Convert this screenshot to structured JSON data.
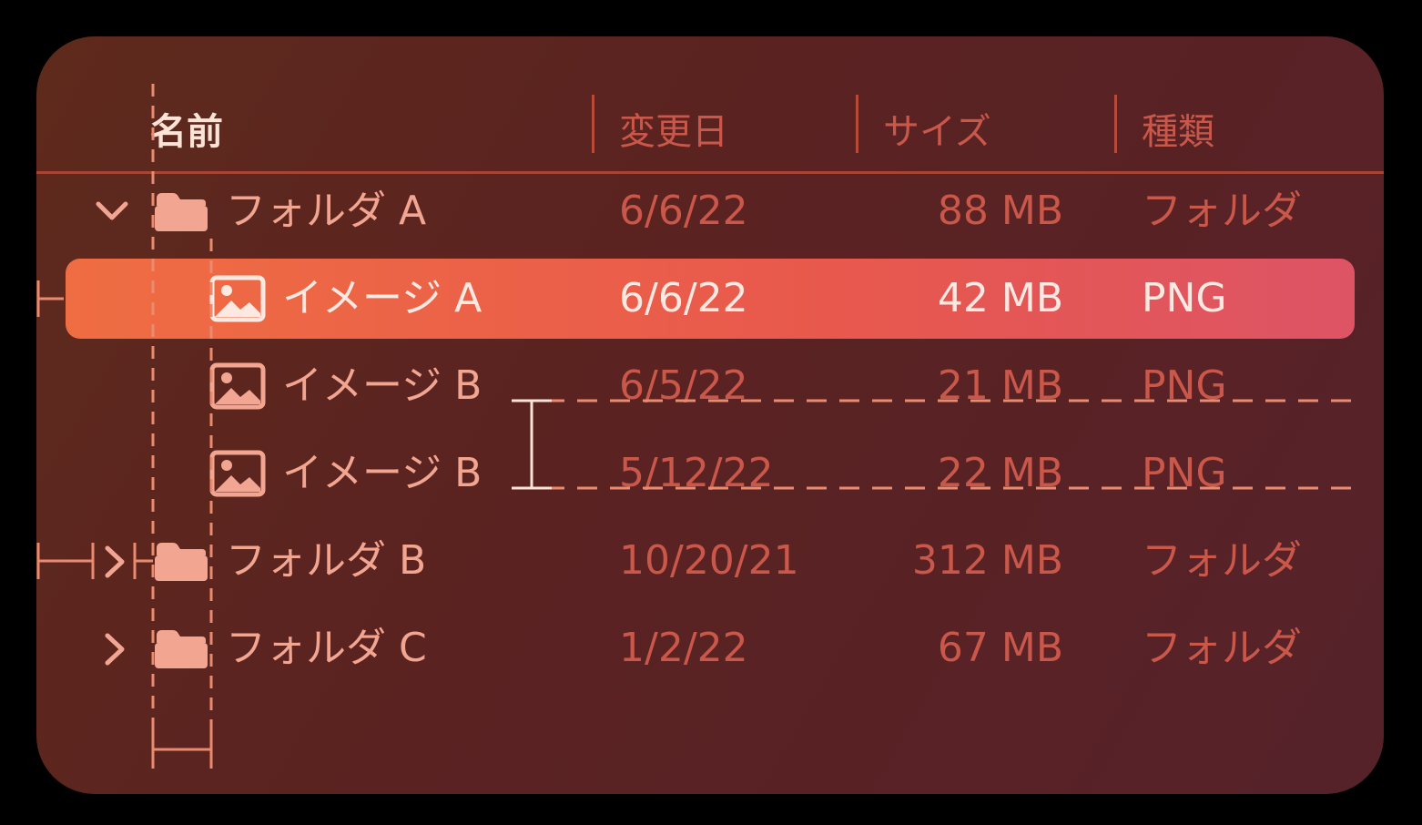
{
  "columns": {
    "name": "名前",
    "modified": "変更日",
    "size": "サイズ",
    "kind": "種類"
  },
  "rows": [
    {
      "name": "フォルダ A",
      "date": "6/6/22",
      "size": "88 MB",
      "kind": "フォルダ",
      "type": "folder",
      "expanded": true,
      "selected": false
    },
    {
      "name": "イメージ A",
      "date": "6/6/22",
      "size": "42 MB",
      "kind": "PNG",
      "type": "image",
      "selected": true
    },
    {
      "name": "イメージ B",
      "date": "6/5/22",
      "size": "21 MB",
      "kind": "PNG",
      "type": "image",
      "selected": false
    },
    {
      "name": "イメージ B",
      "date": "5/12/22",
      "size": "22 MB",
      "kind": "PNG",
      "type": "image",
      "selected": false
    },
    {
      "name": "フォルダ B",
      "date": "10/20/21",
      "size": "312 MB",
      "kind": "フォルダ",
      "type": "folder",
      "expanded": false,
      "selected": false
    },
    {
      "name": "フォルダ C",
      "date": "1/2/22",
      "size": "67 MB",
      "kind": "フォルダ",
      "type": "folder",
      "expanded": false,
      "selected": false
    }
  ],
  "colors": {
    "background": "#000000",
    "panel": "#5b2620",
    "accent": "#ef6d42",
    "row_text": "#f2a691",
    "meta_text": "#c9574a",
    "guide": "#e98b6f"
  },
  "icons": {
    "folder": "folder-icon",
    "image": "image-icon",
    "expanded": "chevron-down-icon",
    "collapsed": "chevron-right-icon"
  }
}
